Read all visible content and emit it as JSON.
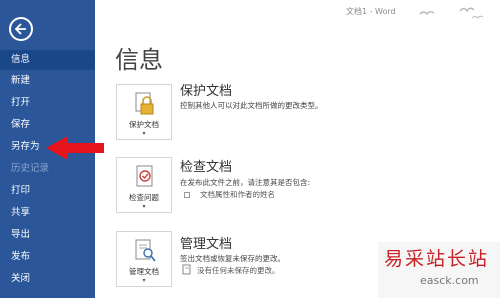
{
  "window": {
    "title": "文档1 - Word"
  },
  "sidebar": {
    "items": [
      {
        "label": "信息",
        "state": "active"
      },
      {
        "label": "新建",
        "state": "normal"
      },
      {
        "label": "打开",
        "state": "normal"
      },
      {
        "label": "保存",
        "state": "normal"
      },
      {
        "label": "另存为",
        "state": "normal"
      },
      {
        "label": "历史记录",
        "state": "disabled"
      },
      {
        "label": "打印",
        "state": "normal"
      },
      {
        "label": "共享",
        "state": "normal"
      },
      {
        "label": "导出",
        "state": "normal"
      },
      {
        "label": "发布",
        "state": "normal"
      },
      {
        "label": "关闭",
        "state": "normal"
      }
    ]
  },
  "main": {
    "title": "信息",
    "sections": [
      {
        "tile_label": "保护文档",
        "tile_icon": "lock-icon",
        "title": "保护文档",
        "description": "控制其他人可以对此文档所做的更改类型。"
      },
      {
        "tile_label": "检查问题",
        "tile_icon": "document-check-icon",
        "title": "检查文档",
        "description": "在发布此文件之前，请注意其是否包含:",
        "subitems": [
          "文档属性和作者的姓名"
        ]
      },
      {
        "tile_label": "管理文档",
        "tile_icon": "document-search-icon",
        "title": "管理文档",
        "description": "签出文档或恢复未保存的更改。",
        "subitems": [
          "没有任何未保存的更改。"
        ]
      }
    ]
  },
  "watermark": {
    "main": "易采站长站",
    "sub": "easck.com"
  },
  "colors": {
    "sidebar": "#2b579a",
    "annotation_arrow": "#e8141b",
    "watermark": "#c72128"
  }
}
